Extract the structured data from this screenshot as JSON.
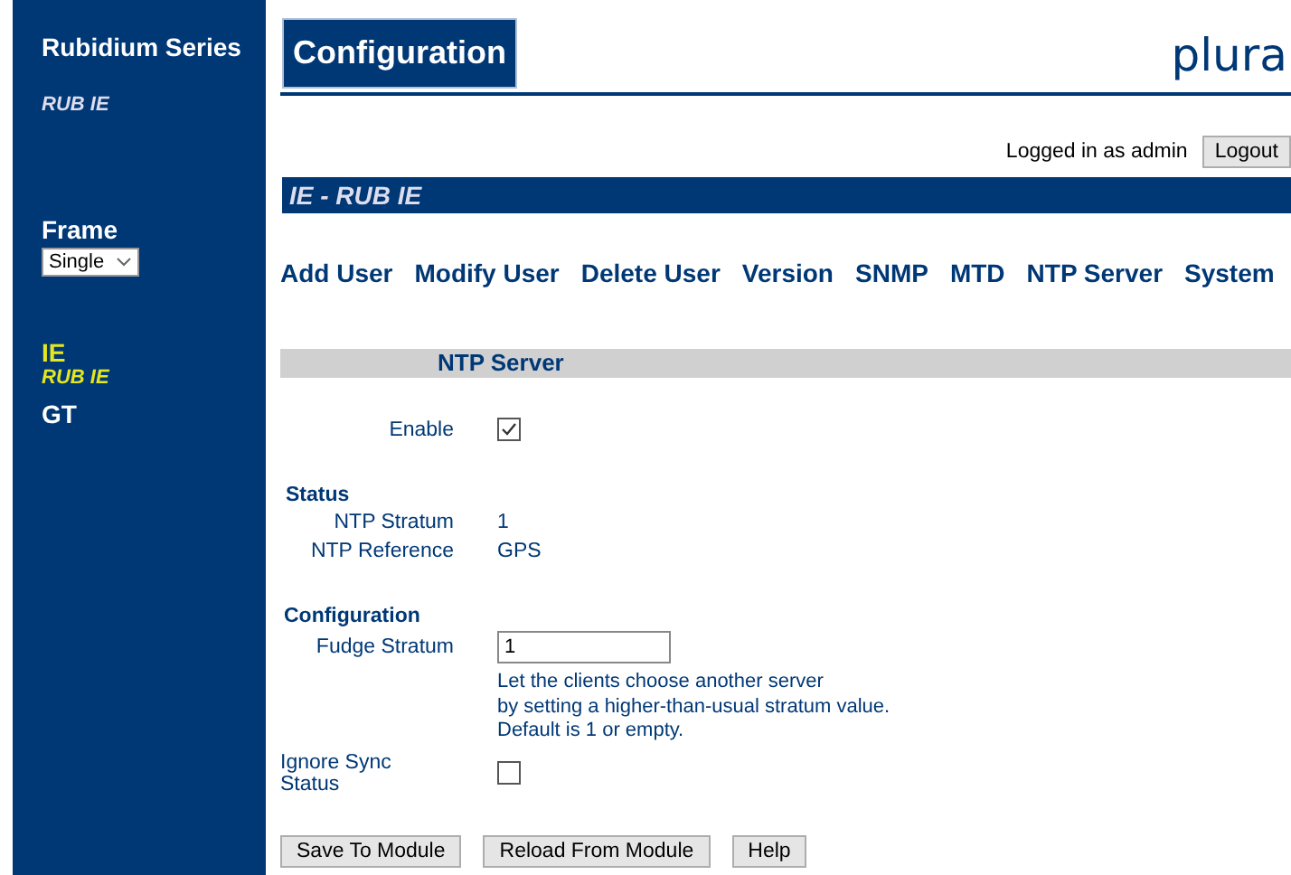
{
  "sidebar": {
    "title": "Rubidium Series",
    "subtitle": "RUB IE",
    "frame_label": "Frame",
    "frame_select": "Single",
    "modules": [
      {
        "name": "IE",
        "sub": "RUB IE",
        "selected": true
      },
      {
        "name": "GT",
        "selected": false
      }
    ]
  },
  "header": {
    "title": "Configuration",
    "logo": "plura"
  },
  "login": {
    "text": "Logged in as admin",
    "button": "Logout"
  },
  "banner": "IE - RUB IE",
  "nav": [
    "Add User",
    "Modify User",
    "Delete User",
    "Version",
    "SNMP",
    "MTD",
    "NTP Server",
    "System"
  ],
  "section": "NTP Server",
  "enable": {
    "label": "Enable",
    "checked": true
  },
  "status": {
    "heading": "Status",
    "rows": [
      {
        "label": "NTP Stratum",
        "value": "1"
      },
      {
        "label": "NTP Reference",
        "value": "GPS"
      }
    ]
  },
  "configuration": {
    "heading": "Configuration",
    "fudge": {
      "label": "Fudge Stratum",
      "value": "1"
    },
    "help": [
      "Let the clients choose another server",
      "by setting a higher-than-usual stratum value.",
      "Default is 1 or empty."
    ],
    "ignore": {
      "label": "Ignore Sync Status",
      "checked": false
    }
  },
  "buttons": [
    "Save To Module",
    "Reload From Module",
    "Help"
  ]
}
